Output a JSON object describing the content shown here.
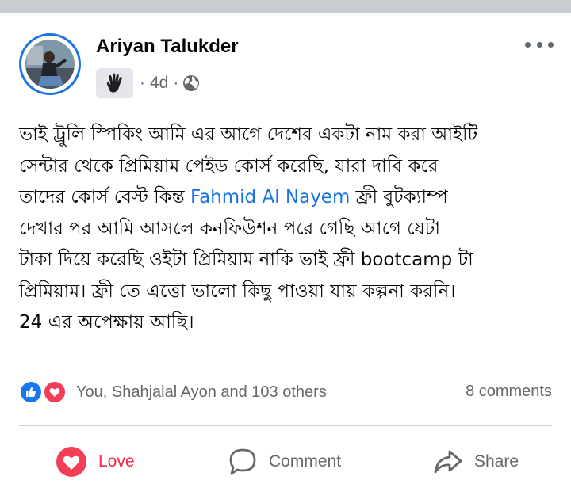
{
  "post": {
    "author": "Ariyan Talukder",
    "time": "4d",
    "meta_separator": "·",
    "badge_icon": "waving-hand-icon",
    "privacy_icon": "globe-icon",
    "text_lines": [
      "ভাই ট্রুলি স্পিকিং আমি এর আগে দেশের একটা নাম করা আইটি",
      "সেন্টার থেকে প্রিমিয়াম পেইড কোর্স করেছি, যারা দাবি করে",
      "তাদের কোর্স বেস্ট কিন্ত ",
      "দেখার পর আমি আসলে কনফিউশন পরে গেছি আগে যেটা",
      "টাকা দিয়ে করেছি ওইটা প্রিমিয়াম নাকি ভাই ফ্রী bootcamp টা",
      "প্রিমিয়াম। ফ্রী তে এত্তো ভালো কিছু পাওয়া যায় কল্পনা করনি।",
      "24  এর অপেক্ষায় আছি।"
    ],
    "mention": "Fahmid Al Nayem",
    "line3_after_mention": " ফ্রী বুটক্যাম্প"
  },
  "reactions": {
    "summary": "You, Shahjalal Ayon and 103 others",
    "comments": "8 comments",
    "icons": [
      "like-icon",
      "love-icon"
    ]
  },
  "actions": {
    "love": "Love",
    "comment": "Comment",
    "share": "Share"
  },
  "colors": {
    "accent": "#1b74e4",
    "love": "#f02849",
    "secondary_text": "#65676b",
    "top_strip": "#c9ccd1"
  }
}
